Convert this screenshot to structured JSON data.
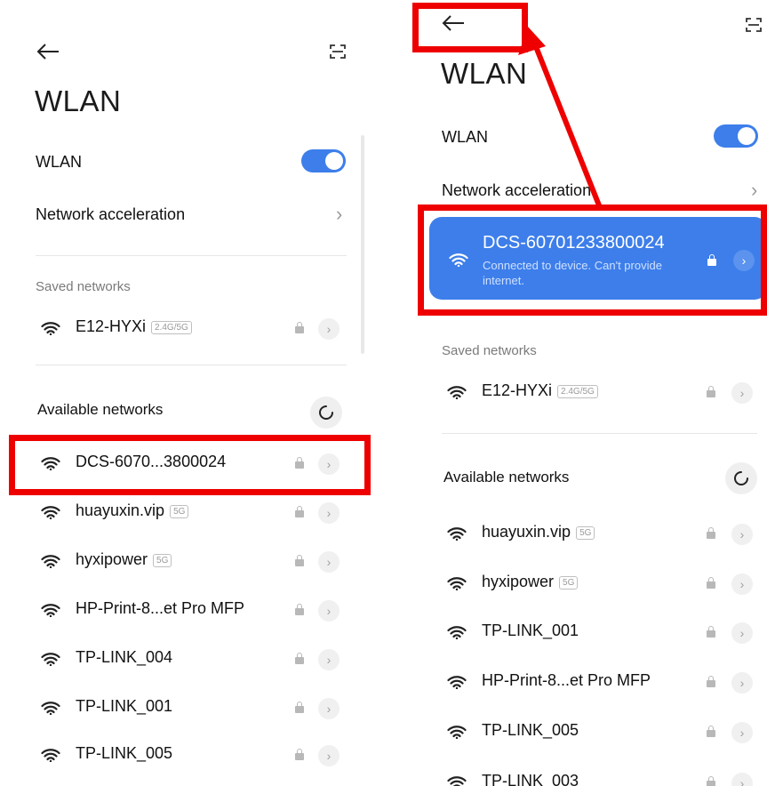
{
  "left": {
    "title": "WLAN",
    "wlan_label": "WLAN",
    "net_accel_label": "Network acceleration",
    "saved_header": "Saved networks",
    "saved_networks": [
      {
        "ssid": "E12-HYXi",
        "band": "2.4G/5G"
      }
    ],
    "available_header": "Available networks",
    "available_networks": [
      {
        "ssid": "DCS-6070...3800024",
        "band": ""
      },
      {
        "ssid": "huayuxin.vip",
        "band": "5G"
      },
      {
        "ssid": "hyxipower",
        "band": "5G"
      },
      {
        "ssid": "HP-Print-8...et Pro MFP",
        "band": ""
      },
      {
        "ssid": "TP-LINK_004",
        "band": ""
      },
      {
        "ssid": "TP-LINK_001",
        "band": ""
      },
      {
        "ssid": "TP-LINK_005",
        "band": ""
      }
    ]
  },
  "right": {
    "title": "WLAN",
    "wlan_label": "WLAN",
    "net_accel_label": "Network acceleration",
    "connected": {
      "ssid": "DCS-60701233800024",
      "status": "Connected to device. Can't provide internet."
    },
    "saved_header": "Saved networks",
    "saved_networks": [
      {
        "ssid": "E12-HYXi",
        "band": "2.4G/5G"
      }
    ],
    "available_header": "Available networks",
    "available_networks": [
      {
        "ssid": "huayuxin.vip",
        "band": "5G"
      },
      {
        "ssid": "hyxipower",
        "band": "5G"
      },
      {
        "ssid": "TP-LINK_001",
        "band": ""
      },
      {
        "ssid": "HP-Print-8...et Pro MFP",
        "band": ""
      },
      {
        "ssid": "TP-LINK_005",
        "band": ""
      },
      {
        "ssid": "TP-LINK_003",
        "band": ""
      }
    ]
  },
  "icons": {
    "back": "back-arrow-icon",
    "scan": "scan-icon",
    "wifi": "wifi-icon",
    "lock": "lock-icon",
    "refresh": "refresh-icon",
    "chevron": "chevron-right-icon"
  },
  "colors": {
    "accent": "#3d7eea",
    "highlight": "#ee0000"
  }
}
